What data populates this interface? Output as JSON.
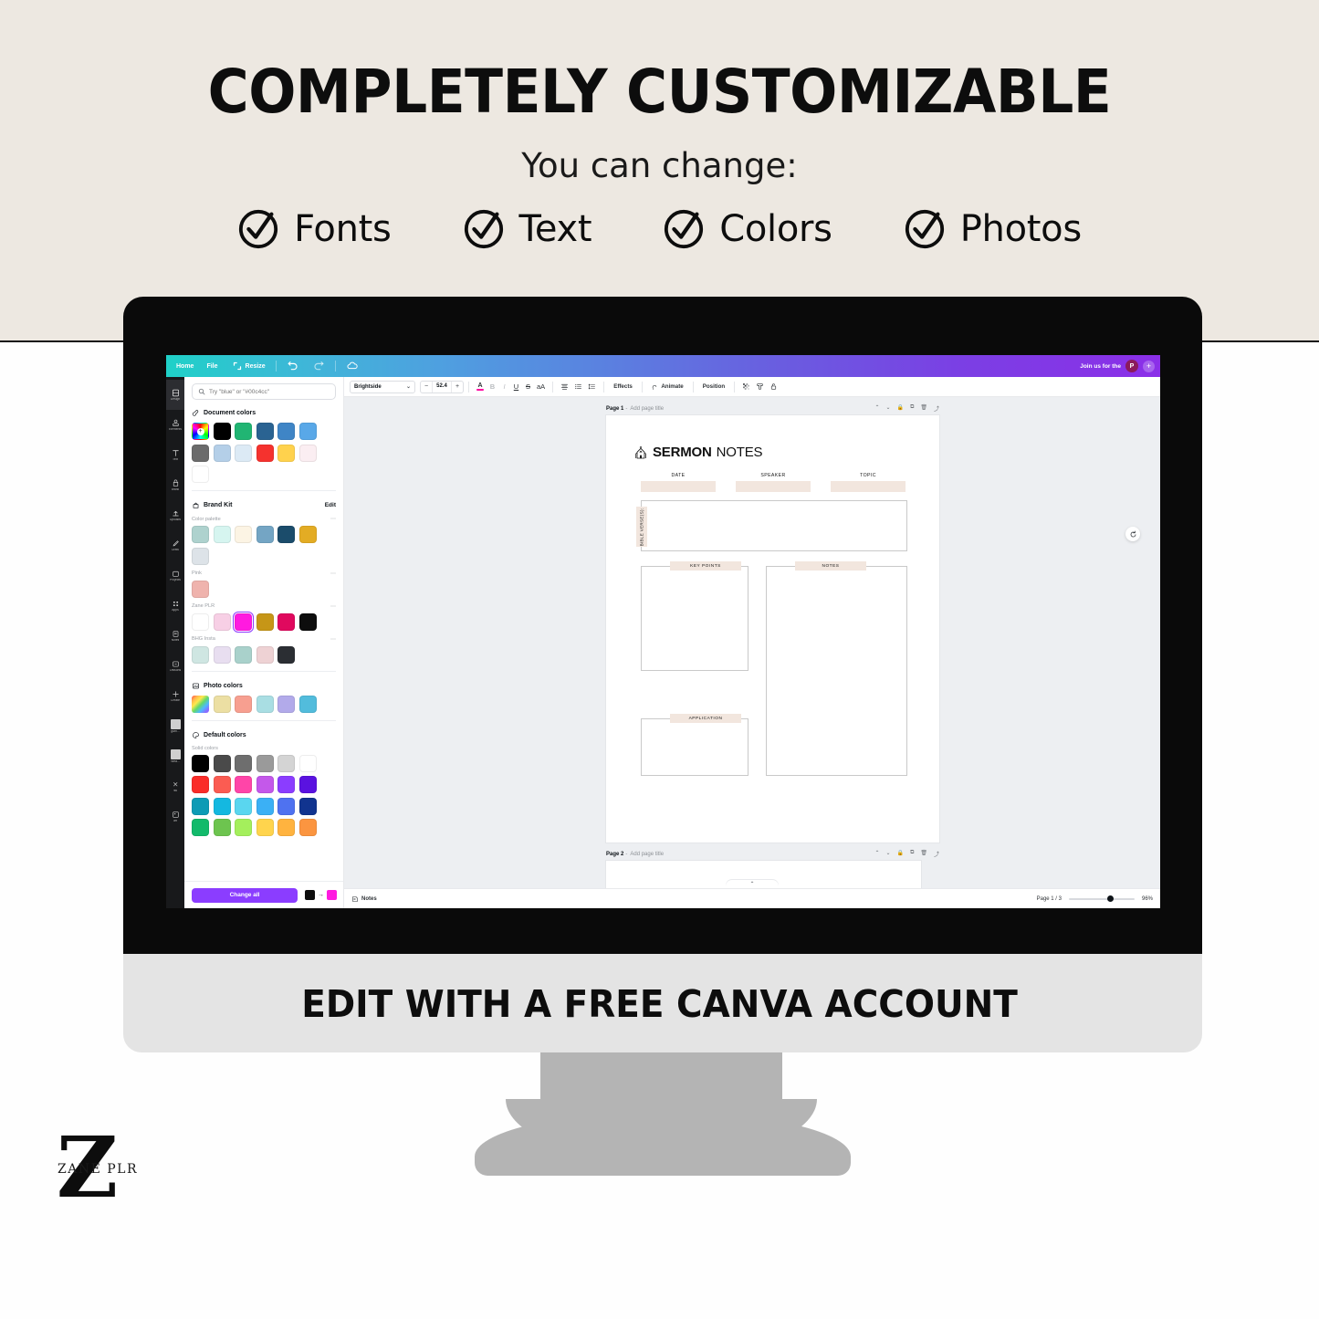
{
  "promo": {
    "headline": "COMPLETELY CUSTOMIZABLE",
    "subhead": "You can change:",
    "checks": [
      {
        "label": "Fonts",
        "icon": "check-circle-icon"
      },
      {
        "label": "Text",
        "icon": "check-circle-icon"
      },
      {
        "label": "Colors",
        "icon": "check-circle-icon"
      },
      {
        "label": "Photos",
        "icon": "check-circle-icon"
      }
    ],
    "base_caption": "EDIT WITH A FREE CANVA ACCOUNT",
    "logo": {
      "letter": "Z",
      "word": "ZANE PLR"
    }
  },
  "app": {
    "appbar": {
      "items": [
        {
          "label": "Home",
          "icon": "home-icon"
        },
        {
          "label": "File",
          "icon": "file-icon"
        },
        {
          "label": "Resize",
          "icon": "resize-icon"
        }
      ],
      "undo_icon": "undo-icon",
      "redo_icon": "redo-icon",
      "cloud_icon": "cloud-sync-icon",
      "join_text": "Join us for the",
      "avatar_initial": "P",
      "plus_label": "+"
    },
    "rail": [
      {
        "label": "Design",
        "icon": "design-icon",
        "active": true
      },
      {
        "label": "Elements",
        "icon": "elements-icon",
        "active": false
      },
      {
        "label": "Text",
        "icon": "text-icon",
        "active": false
      },
      {
        "label": "Brand",
        "icon": "brand-icon",
        "active": false
      },
      {
        "label": "Uploads",
        "icon": "uploads-icon",
        "active": false
      },
      {
        "label": "Draw",
        "icon": "draw-icon",
        "active": false
      },
      {
        "label": "Projects",
        "icon": "projects-icon",
        "active": false
      },
      {
        "label": "Apps",
        "icon": "apps-icon",
        "active": false
      },
      {
        "label": "Notes",
        "icon": "notes-icon",
        "active": false
      },
      {
        "label": "Lessons",
        "icon": "lessons-icon",
        "active": false
      },
      {
        "label": "Create",
        "icon": "create-icon",
        "active": false
      },
      {
        "label": "givin...",
        "icon": "thumbnail-icon",
        "active": false
      },
      {
        "label": "Wea...",
        "icon": "thumbnail-icon",
        "active": false
      },
      {
        "label": "red",
        "icon": "magic-icon",
        "active": false
      },
      {
        "label": "art",
        "icon": "art-icon",
        "active": false
      }
    ],
    "panel": {
      "search": {
        "placeholder": "Try \"blue\" or \"#00c4cc\"",
        "icon": "search-icon"
      },
      "sections": [
        {
          "title": "Document colors",
          "icon": "document-colors-icon",
          "action": null,
          "groups": [
            {
              "label": null,
              "swatches": [
                "rainbow-add",
                "#000000",
                "#21b573",
                "#2a6392",
                "#3f85c6",
                "#59a8e8",
                "#6b6b6b",
                "#b4cfe8",
                "#dceaf5",
                "#f5322e",
                "#ffd24d",
                "#fbeef2",
                "#ffffff"
              ]
            }
          ]
        },
        {
          "title": "Brand Kit",
          "icon": "brand-kit-icon",
          "action": "Edit",
          "groups": [
            {
              "label": "Color palette",
              "swatches": [
                "#aed2ce",
                "#d6f5f0",
                "#fcf4e4",
                "#74a5c4",
                "#1b4c6b",
                "#e3ac24",
                "#dde3e8"
              ]
            },
            {
              "label": "Pink",
              "swatches": [
                "#efb3ad"
              ]
            },
            {
              "label": "Zane PLR",
              "swatches": [
                "#ffffff",
                "#f7cfe5",
                "#ff1ae0",
                "#c69617",
                "#e0095e",
                "#0d0d0d"
              ],
              "selected_index": 2
            },
            {
              "label": "BHG Insta",
              "swatches": [
                "#cfe6e2",
                "#e8def0",
                "#a9d1cb",
                "#eed2d4",
                "#2b2e33"
              ]
            }
          ]
        },
        {
          "title": "Photo colors",
          "icon": "photo-colors-icon",
          "action": null,
          "groups": [
            {
              "label": null,
              "swatches": [
                "rainbow-photo",
                "#ecdfa3",
                "#f79f90",
                "#a9dee3",
                "#b2aaea",
                "#52bcdc"
              ]
            }
          ]
        },
        {
          "title": "Default colors",
          "icon": "default-colors-icon",
          "action": null,
          "groups": [
            {
              "label": "Solid colors",
              "swatches": [
                "#000000",
                "#4a4a4a",
                "#6e6e6e",
                "#9a9a9a",
                "#d4d4d4",
                "#ffffff",
                "#fa2d29",
                "#fb5c52",
                "#ff45a8",
                "#c458ea",
                "#8b3dff",
                "#5a12e0",
                "#0d9bb5",
                "#14b8e0",
                "#5ad6ef",
                "#3bb0f5",
                "#4f72f0",
                "#11348f",
                "#12ba6b",
                "#6dc44f",
                "#a4ef5c",
                "#ffd44d",
                "#ffb33f",
                "#fb9540"
              ]
            }
          ]
        }
      ],
      "footer": {
        "change_all_label": "Change all",
        "from_color": "#0d0d0d",
        "arrow": "→",
        "to_color": "#ff1ae0"
      }
    },
    "toolbar": {
      "font_name": "Brightside",
      "chevron": "⌄",
      "minus": "−",
      "font_size": "52.4",
      "plus": "+",
      "text_color_letter": "A",
      "bold": "B",
      "italic": "I",
      "underline": "U",
      "strike": "S",
      "case_label": "aA",
      "align_icon": "align-icon",
      "list_icon": "bullet-list-icon",
      "spacing_icon": "line-spacing-icon",
      "effects_label": "Effects",
      "animate_label": "Animate",
      "animate_icon": "animate-icon",
      "position_label": "Position",
      "transparency_icon": "transparency-icon",
      "copy_style_icon": "copy-style-icon",
      "lock_icon": "lock-icon"
    },
    "pages": [
      {
        "name": "Page 1",
        "title": "Add page title"
      },
      {
        "name": "Page 2",
        "title": "Add page title"
      }
    ],
    "page_tools": [
      "chevron-up-icon",
      "chevron-down-icon",
      "lock-icon",
      "duplicate-icon",
      "delete-icon",
      "export-icon"
    ],
    "refresh_icon": "refresh-icon",
    "bottombar": {
      "notes_label": "Notes",
      "notes_icon": "notes-icon",
      "page_indicator": "Page 1 / 3",
      "zoom_level": "96%",
      "collapse_icon": "chevron-up-icon"
    },
    "document": {
      "title_bold": "SERMON",
      "title_light": "NOTES",
      "logo_icon": "church-icon",
      "fields": [
        "DATE",
        "SPEAKER",
        "TOPIC"
      ],
      "verse_label": "BIBLE VERSE(S):",
      "sections": [
        "KEY POINTS",
        "NOTES",
        "APPLICATION"
      ],
      "accent_color": "#f2e6de",
      "outline_color": "#c9c9c9"
    }
  }
}
